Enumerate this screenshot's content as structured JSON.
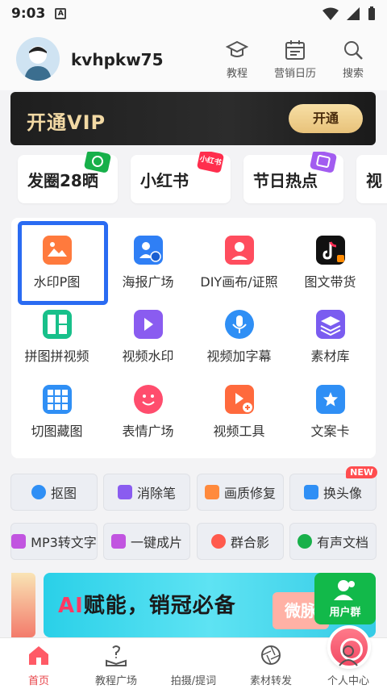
{
  "status": {
    "time": "9:03",
    "notif": "A"
  },
  "profile": {
    "username": "kvhpkw75"
  },
  "top_actions": [
    {
      "label": "教程",
      "icon": "graduation-cap-icon"
    },
    {
      "label": "营销日历",
      "icon": "calendar-icon"
    },
    {
      "label": "搜索",
      "icon": "search-icon"
    }
  ],
  "vip": {
    "title": "开通VIP",
    "button": "开通"
  },
  "topics": [
    {
      "label": "发圈28晒",
      "badge": "",
      "badge_color": "#17b04a"
    },
    {
      "label": "小红书",
      "badge": "小红书",
      "badge_color": "#ff2e4d"
    },
    {
      "label": "节日热点",
      "badge": "",
      "badge_color": "#a25cf0"
    },
    {
      "label": "视",
      "badge": "",
      "badge_color": "#ff8a00"
    }
  ],
  "tools": [
    {
      "label": "水印P图",
      "icon": "watermark-photo-icon",
      "color": "#ff7a3d"
    },
    {
      "label": "海报广场",
      "icon": "poster-icon",
      "color": "#2f7ff5"
    },
    {
      "label": "DIY画布/证照",
      "icon": "diy-canvas-icon",
      "color": "#ff4d5e"
    },
    {
      "label": "图文带货",
      "icon": "tiktok-icon",
      "color": "#111111"
    },
    {
      "label": "拼图拼视频",
      "icon": "collage-icon",
      "color": "#18c08a"
    },
    {
      "label": "视频水印",
      "icon": "video-watermark-icon",
      "color": "#8a5cf0"
    },
    {
      "label": "视频加字幕",
      "icon": "microphone-icon",
      "color": "#2f8ff5"
    },
    {
      "label": "素材库",
      "icon": "layers-icon",
      "color": "#7a5cf0"
    },
    {
      "label": "切图藏图",
      "icon": "grid-cut-icon",
      "color": "#2f8ff5"
    },
    {
      "label": "表情广场",
      "icon": "emoji-icon",
      "color": "#ff4d6d"
    },
    {
      "label": "视频工具",
      "icon": "video-tool-icon",
      "color": "#ff6a3d"
    },
    {
      "label": "文案卡",
      "icon": "star-card-icon",
      "color": "#2f8ff5"
    }
  ],
  "quick_chips": [
    {
      "label": "抠图",
      "icon": "cutout-icon",
      "color": "#2f8ff5",
      "badge": ""
    },
    {
      "label": "消除笔",
      "icon": "magic-wand-icon",
      "color": "#8a5cf0",
      "badge": ""
    },
    {
      "label": "画质修复",
      "icon": "hd-icon",
      "color": "#ff8a3d",
      "badge": ""
    },
    {
      "label": "换头像",
      "icon": "face-swap-icon",
      "color": "#2f8ff5",
      "badge": "NEW"
    },
    {
      "label": "MP3转文字",
      "icon": "music-note-icon",
      "color": "#c154e0",
      "badge": ""
    },
    {
      "label": "一键成片",
      "icon": "play-icon",
      "color": "#c154e0",
      "badge": ""
    },
    {
      "label": "群合影",
      "icon": "group-photo-icon",
      "color": "#ff5a4d",
      "badge": ""
    },
    {
      "label": "有声文档",
      "icon": "mic-doc-icon",
      "color": "#18b04a",
      "badge": ""
    }
  ],
  "promo": {
    "prefix": "AI",
    "text": "赋能，销冠必备",
    "mini": "微脉",
    "group_label": "用户群"
  },
  "bottom_nav": [
    {
      "label": "首页",
      "icon": "home-icon",
      "active": true
    },
    {
      "label": "教程广场",
      "icon": "tutorial-icon",
      "active": false
    },
    {
      "label": "拍摄/提词",
      "icon": "camera-icon",
      "active": false
    },
    {
      "label": "素材转发",
      "icon": "aperture-icon",
      "active": false
    },
    {
      "label": "个人中心",
      "icon": "person-icon",
      "active": false
    }
  ],
  "colors": {
    "accent": "#e8444a",
    "select": "#2a6bf2",
    "vip_gold": "#f2d9a4"
  }
}
